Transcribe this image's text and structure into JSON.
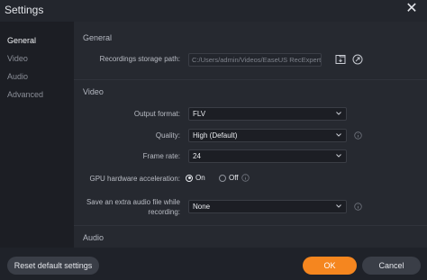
{
  "window": {
    "title": "Settings"
  },
  "sidebar": {
    "items": [
      {
        "label": "General",
        "active": true
      },
      {
        "label": "Video",
        "active": false
      },
      {
        "label": "Audio",
        "active": false
      },
      {
        "label": "Advanced",
        "active": false
      }
    ]
  },
  "general": {
    "section_title": "General",
    "storage_label": "Recordings storage path:",
    "storage_value": "C:/Users/admin/Videos/EaseUS RecExperts"
  },
  "video": {
    "section_title": "Video",
    "output_format_label": "Output format:",
    "output_format_value": "FLV",
    "quality_label": "Quality:",
    "quality_value": "High (Default)",
    "frame_rate_label": "Frame rate:",
    "frame_rate_value": "24",
    "gpu_label": "GPU hardware acceleration:",
    "gpu_on_label": "On",
    "gpu_off_label": "Off",
    "gpu_selected": "On",
    "extra_audio_label_line1": "Save an extra audio file while",
    "extra_audio_label_line2": "recording:",
    "extra_audio_value": "None"
  },
  "audio": {
    "section_title": "Audio"
  },
  "footer": {
    "reset_label": "Reset default settings",
    "ok_label": "OK",
    "cancel_label": "Cancel"
  },
  "colors": {
    "accent": "#f5861f",
    "background": "#1f2229",
    "panel": "#262930"
  },
  "icons": [
    "close-icon",
    "folder-icon",
    "open-folder-icon",
    "info-icon",
    "chevron-down-icon"
  ]
}
